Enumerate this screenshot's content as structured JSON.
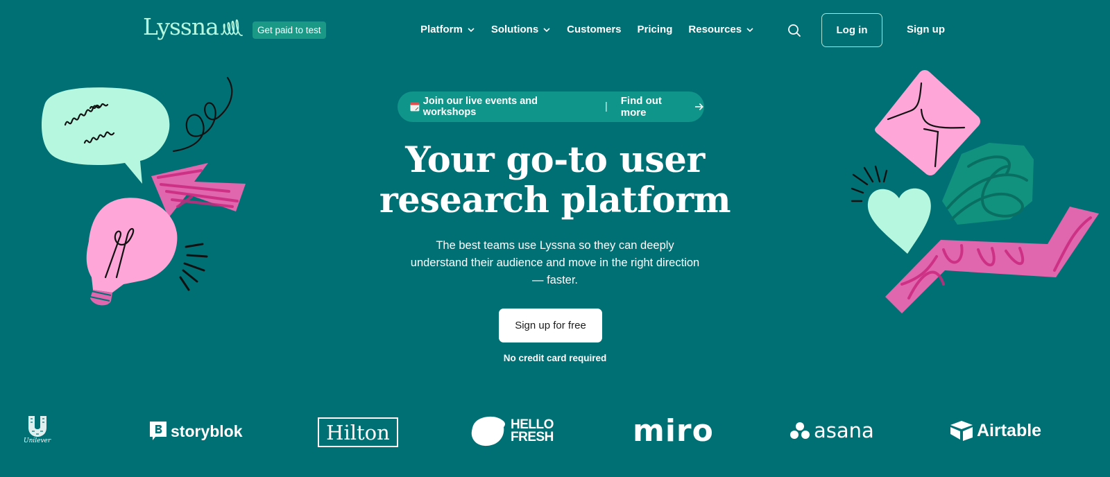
{
  "header": {
    "logo_text": "Lyssna",
    "badge": "Get paid to test",
    "nav": [
      {
        "label": "Platform",
        "has_dropdown": true
      },
      {
        "label": "Solutions",
        "has_dropdown": true
      },
      {
        "label": "Customers",
        "has_dropdown": false
      },
      {
        "label": "Pricing",
        "has_dropdown": false
      },
      {
        "label": "Resources",
        "has_dropdown": true
      }
    ],
    "search_icon": "search-icon",
    "login_label": "Log in",
    "signup_label": "Sign up"
  },
  "hero": {
    "event_pill": {
      "icon": "calendar-icon",
      "text": "Join our live events and workshops",
      "divider": "|",
      "link_label": "Find out more",
      "link_icon": "arrow-right-icon"
    },
    "headline_line1": "Your go-to user",
    "headline_line2": "research platform",
    "subtext": "The best teams use Lyssna so they can deeply understand their audience and move in the right direction — faster.",
    "cta_label": "Sign up for free",
    "cta_note": "No credit card required"
  },
  "logos": [
    {
      "name": "Unilever",
      "text": "Unilever"
    },
    {
      "name": "Storyblok",
      "text": "storyblok"
    },
    {
      "name": "Hilton",
      "text": "Hilton"
    },
    {
      "name": "HelloFresh",
      "text_line1": "HELLO",
      "text_line2": "FRESH"
    },
    {
      "name": "Miro",
      "text": "miro"
    },
    {
      "name": "Asana",
      "text": "asana"
    },
    {
      "name": "Airtable",
      "text": "Airtable"
    }
  ],
  "colors": {
    "background": "#007074",
    "logo_mint": "#b6f7e0",
    "badge_bg": "#1a9987",
    "pill_bg": "#10958a",
    "illus_pink": "#ffa6d9",
    "illus_magenta": "#d63b94",
    "illus_mint": "#b6f7e0",
    "illus_green": "#11927f"
  }
}
